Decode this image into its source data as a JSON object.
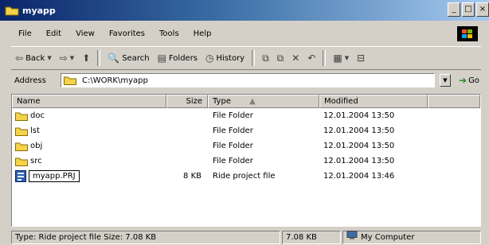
{
  "window": {
    "title": "myapp",
    "controls": [
      "_",
      "□",
      "×"
    ]
  },
  "menu": [
    "File",
    "Edit",
    "View",
    "Favorites",
    "Tools",
    "Help"
  ],
  "toolbar": {
    "back": "Back",
    "search": "Search",
    "folders": "Folders",
    "history": "History"
  },
  "address": {
    "label": "Address",
    "path": "C:\\WORK\\myapp",
    "go": "Go"
  },
  "columns": {
    "name": "Name",
    "size": "Size",
    "type": "Type",
    "modified": "Modified"
  },
  "files": [
    {
      "name": "doc",
      "size": "",
      "type": "File Folder",
      "modified": "12.01.2004 13:50",
      "icon": "folder-icon"
    },
    {
      "name": "lst",
      "size": "",
      "type": "File Folder",
      "modified": "12.01.2004 13:50",
      "icon": "folder-icon"
    },
    {
      "name": "obj",
      "size": "",
      "type": "File Folder",
      "modified": "12.01.2004 13:50",
      "icon": "folder-icon"
    },
    {
      "name": "src",
      "size": "",
      "type": "File Folder",
      "modified": "12.01.2004 13:50",
      "icon": "folder-icon"
    },
    {
      "name": "myapp.PRJ",
      "size": "8 KB",
      "type": "Ride project file",
      "modified": "12.01.2004 13:46",
      "icon": "project-file-icon"
    }
  ],
  "status": {
    "info": "Type: Ride project file Size: 7.08 KB",
    "size": "7.08 KB",
    "zone": "My Computer"
  }
}
